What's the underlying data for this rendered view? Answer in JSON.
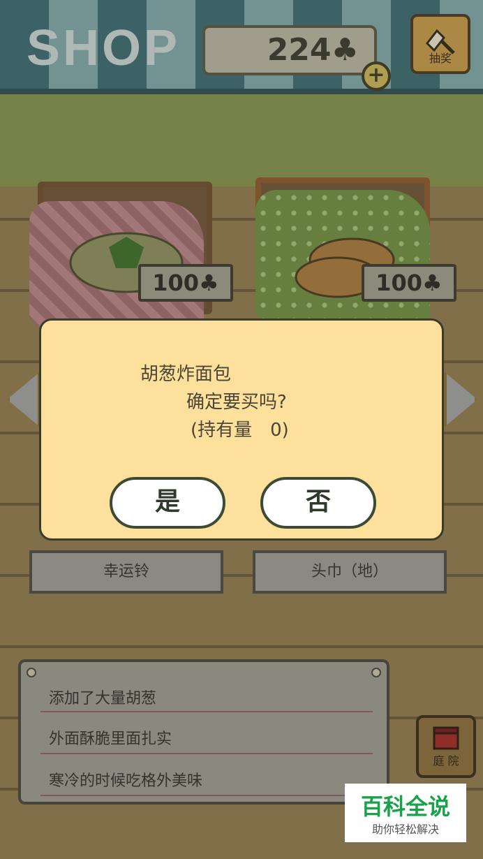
{
  "header": {
    "title": "SHOP",
    "coins": "224",
    "coin_icon": "clover-icon",
    "add_coins_label": "+",
    "lottery_label": "抽奖"
  },
  "items": [
    {
      "price": "100",
      "name": "幸运铃"
    },
    {
      "price": "100",
      "name": "头巾（地）"
    }
  ],
  "dialog": {
    "item_name": "胡葱炸面包",
    "question": "确定要买吗?",
    "owned": "(持有量　0)",
    "yes_label": "是",
    "no_label": "否"
  },
  "description": {
    "lines": [
      "添加了大量胡葱",
      "外面酥脆里面扎实",
      "寒冷的时候吃格外美味"
    ]
  },
  "nav": {
    "yard_label": "庭 院"
  },
  "watermark": {
    "title": "百科全说",
    "subtitle": "助你轻松解决"
  },
  "colors": {
    "dialog_bg": "#fde09c",
    "watermark_green": "#18a34a"
  }
}
